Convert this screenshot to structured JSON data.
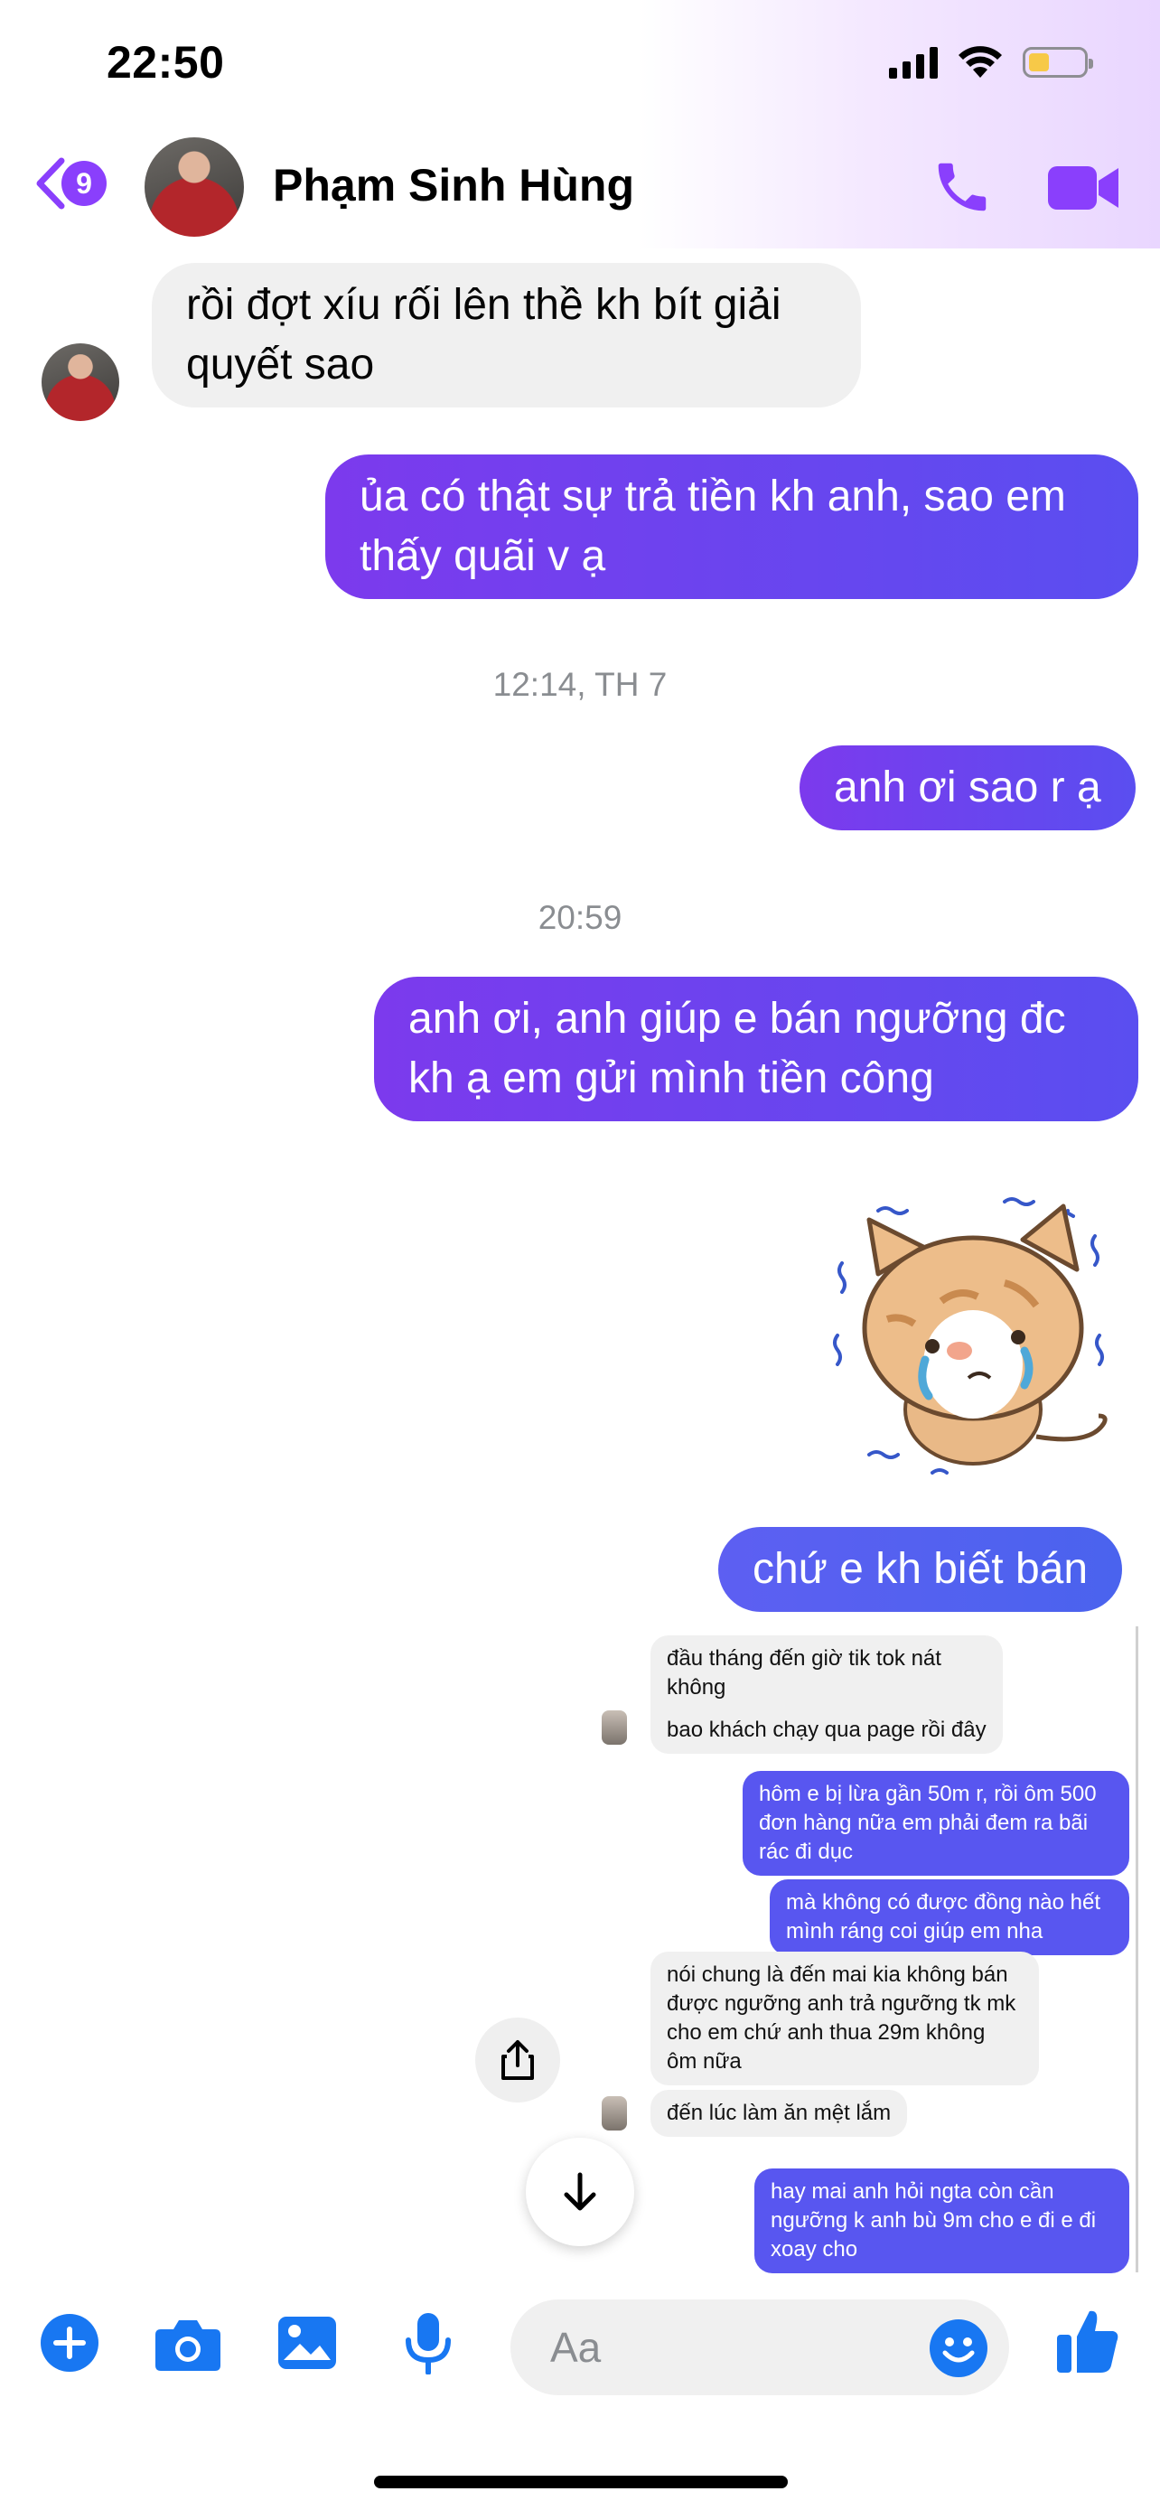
{
  "status_bar": {
    "time": "22:50"
  },
  "header": {
    "back_badge": "9",
    "contact_name": "Phạm Sinh Hùng",
    "colors": {
      "accent": "#8a3ffc"
    }
  },
  "messages": [
    {
      "side": "in",
      "text": "rồi đợt xíu rối lên thề kh bít giải\nquyết sao"
    },
    {
      "side": "out",
      "text": "ủa có thật sự trả tiền kh anh, sao em\nthấy quãi v ạ"
    },
    {
      "stamp": "12:14, TH 7"
    },
    {
      "side": "out",
      "text": "anh ơi sao r ạ"
    },
    {
      "stamp": "20:59"
    },
    {
      "side": "out",
      "text": "anh ơi, anh giúp e bán ngưỡng đc\nkh ạ em gửi mình tiền công"
    },
    {
      "sticker": "crying-cat-sticker"
    },
    {
      "side": "out",
      "text": "chứ e kh biết bán"
    }
  ],
  "screenshot_messages": [
    {
      "side": "in",
      "text": "đầu tháng đến giờ tik tok nát không\ncòn gì"
    },
    {
      "side": "in",
      "text": "bao khách chạy qua page rồi đây"
    },
    {
      "side": "out",
      "text": "hôm e bị lừa gần 50m r, rồi ôm 500\nđơn hàng nữa em phải đem ra bãi\nrác đi dục"
    },
    {
      "side": "out",
      "text": "mà không có được đồng nào hết\nmình ráng coi giúp em nha"
    },
    {
      "side": "in",
      "text": "nói chung là đến  mai kia không bán\nđược ngưỡng anh trả ngưỡng tk mk\ncho em chứ anh thua 29m không\nôm nữa"
    },
    {
      "side": "in",
      "text": "đến lúc làm ăn mệt lắm"
    },
    {
      "side": "out",
      "text": "hay mai anh hỏi ngta còn cần\nngưỡng k anh bù 9m cho e đi e đi\nxoay cho"
    }
  ],
  "composer": {
    "placeholder": "Aa",
    "icons": [
      "plus-icon",
      "camera-icon",
      "image-icon",
      "microphone-icon",
      "emoji-icon",
      "thumbs-up-icon"
    ],
    "accent": "#1877f2"
  }
}
